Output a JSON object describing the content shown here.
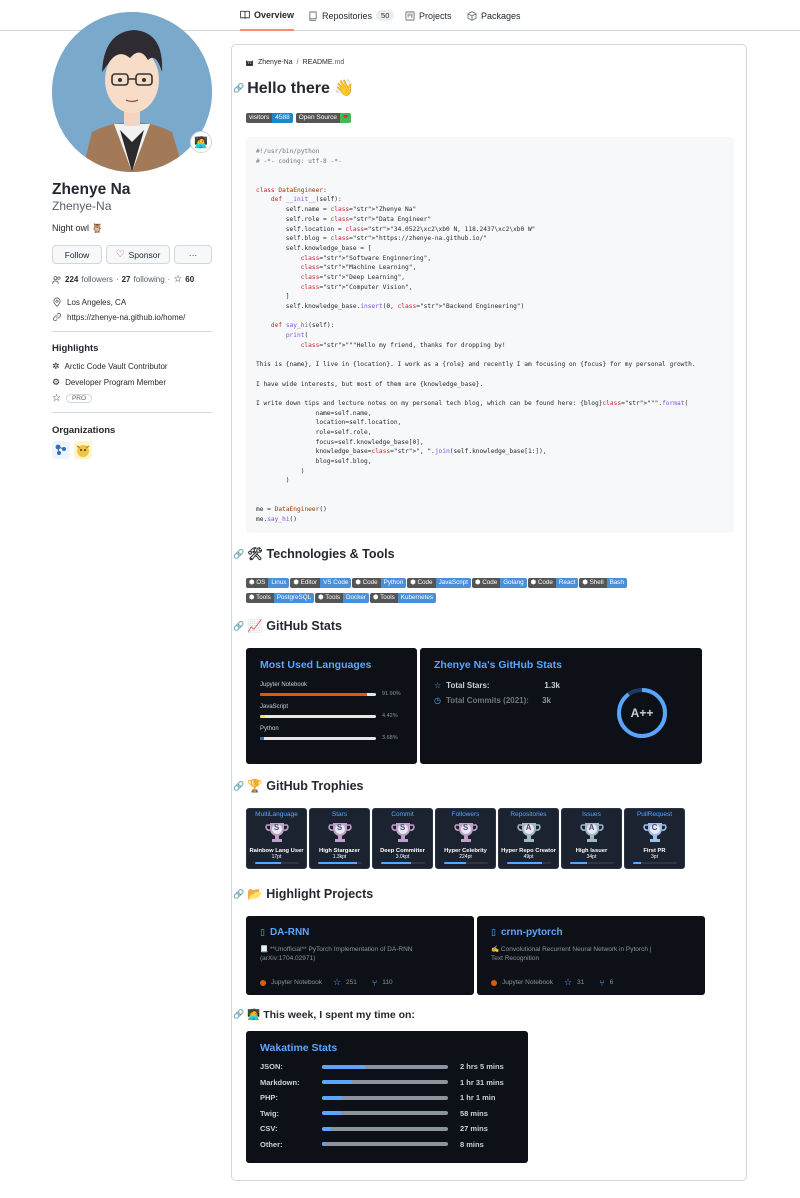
{
  "nav": {
    "tabs": [
      {
        "label": "Overview",
        "icon": "book-icon"
      },
      {
        "label": "Repositories",
        "icon": "repo-icon",
        "count": "50"
      },
      {
        "label": "Projects",
        "icon": "project-icon"
      },
      {
        "label": "Packages",
        "icon": "package-icon"
      }
    ]
  },
  "profile": {
    "name": "Zhenye Na",
    "login": "Zhenye-Na",
    "bio": "Night owl 🦉",
    "status_emoji": "🧑‍💻",
    "follow_label": "Follow",
    "sponsor_label": "Sponsor",
    "more_label": "···",
    "followers": "224",
    "followers_label": "followers",
    "following": "27",
    "following_label": "following",
    "stars": "60",
    "location": "Los Angeles, CA",
    "website": "https://zhenye-na.github.io/home/"
  },
  "highlights": {
    "title": "Highlights",
    "items": [
      "Arctic Code Vault Contributor",
      "Developer Program Member"
    ],
    "pro": "PRO"
  },
  "organizations": {
    "title": "Organizations"
  },
  "readme": {
    "owner": "Zhenye-Na",
    "sep": "/",
    "file": "README",
    "ext": ".md",
    "heading": "Hello there 👋",
    "badge_visitors_label": "visitors",
    "badge_visitors_value": "4588",
    "badge_os_label": "Open Source",
    "badge_os_value": "❤",
    "tech_heading": "🛠 Technologies & Tools",
    "stats_heading": "📈 GitHub Stats",
    "trophies_heading": "🏆 GitHub Trophies",
    "projects_heading": "📂 Highlight Projects",
    "week_heading": "🧑‍💻 This week, I spent my time on:"
  },
  "tech_badges": [
    {
      "l": "OS",
      "r": "Linux",
      "color": "#4a90d9"
    },
    {
      "l": "Editor",
      "r": "VS Code",
      "color": "#4a90d9"
    },
    {
      "l": "Code",
      "r": "Python",
      "color": "#4a90d9"
    },
    {
      "l": "Code",
      "r": "JavaScript",
      "color": "#4a90d9"
    },
    {
      "l": "Code",
      "r": "Golang",
      "color": "#4a90d9"
    },
    {
      "l": "Code",
      "r": "React",
      "color": "#4a90d9"
    },
    {
      "l": "Shell",
      "r": "Bash",
      "color": "#4a90d9"
    },
    {
      "l": "Tools",
      "r": "PostgreSQL",
      "color": "#4a90d9"
    },
    {
      "l": "Tools",
      "r": "Docker",
      "color": "#4a90d9"
    },
    {
      "l": "Tools",
      "r": "Kubernetes",
      "color": "#4a90d9"
    }
  ],
  "languages_card": {
    "title": "Most Used Languages",
    "items": [
      {
        "name": "Jupyter Notebook",
        "pct": "91.90%",
        "value": 91.9,
        "color": "#DA5B0B"
      },
      {
        "name": "JavaScript",
        "pct": "4.42%",
        "value": 4.42,
        "color": "#f1e05a"
      },
      {
        "name": "Python",
        "pct": "3.68%",
        "value": 3.68,
        "color": "#3572A5"
      }
    ]
  },
  "stats_card": {
    "title": "Zhenye Na's GitHub Stats",
    "stars_label": "Total Stars:",
    "stars_value": "1.3k",
    "commits_label": "Total Commits (2021):",
    "commits_value": "3k",
    "grade": "A++"
  },
  "trophies": [
    {
      "cat": "MultiLanguage",
      "rank": "S",
      "label": "Rainbow Lang User",
      "pts": "17pt",
      "progress": 0.6,
      "color": "#c0a0c8"
    },
    {
      "cat": "Stars",
      "rank": "S",
      "label": "High Stargazer",
      "pts": "1.3kpt",
      "progress": 0.9,
      "color": "#c0a0c8"
    },
    {
      "cat": "Commit",
      "rank": "S",
      "label": "Deep Committer",
      "pts": "3.0kpt",
      "progress": 0.7,
      "color": "#c0a0c8"
    },
    {
      "cat": "Followers",
      "rank": "S",
      "label": "Hyper Celebrity",
      "pts": "224pt",
      "progress": 0.5,
      "color": "#c0a0c8"
    },
    {
      "cat": "Repositories",
      "rank": "A",
      "label": "Hyper Repo Creator",
      "pts": "49pt",
      "progress": 0.8,
      "color": "#a0b8c8"
    },
    {
      "cat": "Issues",
      "rank": "A",
      "label": "High Issuer",
      "pts": "34pt",
      "progress": 0.4,
      "color": "#a0b8c8"
    },
    {
      "cat": "PullRequest",
      "rank": "C",
      "label": "First PR",
      "pts": "3pt",
      "progress": 0.2,
      "color": "#a0c0e8"
    }
  ],
  "projects": [
    {
      "name": "DA-RNN",
      "desc1": "📃 **Unofficial** PyTorch Implementation of DA-RNN",
      "desc2": "(arXiv:1704.02971)",
      "lang": "Jupyter Notebook",
      "stars": "251",
      "forks": "110"
    },
    {
      "name": "crnn-pytorch",
      "desc1": "✍️ Convolutional Recurrent Neural Network in Pytorch |",
      "desc2": "Text Recognition",
      "lang": "Jupyter Notebook",
      "stars": "31",
      "forks": "6"
    }
  ],
  "wakatime": {
    "title": "Wakatime Stats",
    "items": [
      {
        "name": "JSON:",
        "time": "2 hrs 5 mins",
        "value": 0.34
      },
      {
        "name": "Markdown:",
        "time": "1 hr 31 mins",
        "value": 0.24
      },
      {
        "name": "PHP:",
        "time": "1 hr 1 min",
        "value": 0.16
      },
      {
        "name": "Twig:",
        "time": "58 mins",
        "value": 0.15
      },
      {
        "name": "CSV:",
        "time": "27 mins",
        "value": 0.07
      },
      {
        "name": "Other:",
        "time": "8 mins",
        "value": 0.02
      }
    ]
  },
  "code_lines": [
    "#!/usr/bin/python",
    "# -*- coding: utf-8 -*-",
    "",
    "",
    "class DataEngineer:",
    "    def __init__(self):",
    "        self.name = \"Zhenye Na\"",
    "        self.role = \"Data Engineer\"",
    "        self.location = \"34.0522\\xc2\\xb0 N, 118.2437\\xc2\\xb0 W\"",
    "        self.blog = \"https://zhenye-na.github.io/\"",
    "        self.knowledge_base = [",
    "            \"Software Enginnering\",",
    "            \"Machine Learning\",",
    "            \"Deep Learning\",",
    "            \"Computer Vision\",",
    "        ]",
    "        self.knowledge_base.insert(0, \"Backend Engineering\")",
    "",
    "    def say_hi(self):",
    "        print(",
    "            \"\"\"Hello my friend, thanks for dropping by!",
    "",
    "This is {name}, I live in {location}. I work as a {role} and recently I am focusing on {focus} for my personal growth.",
    "",
    "I have wide interests, but most of them are {knowledge_base}.",
    "",
    "I write down tips and lecture notes on my personal tech blog, which can be found here: {blog}\"\"\".format(",
    "                name=self.name,",
    "                location=self.location,",
    "                role=self.role,",
    "                focus=self.knowledge_base[0],",
    "                knowledge_base=\", \".join(self.knowledge_base[1:]),",
    "                blog=self.blog,",
    "            )",
    "        )",
    "",
    "",
    "me = DataEngineer()",
    "me.say_hi()"
  ]
}
